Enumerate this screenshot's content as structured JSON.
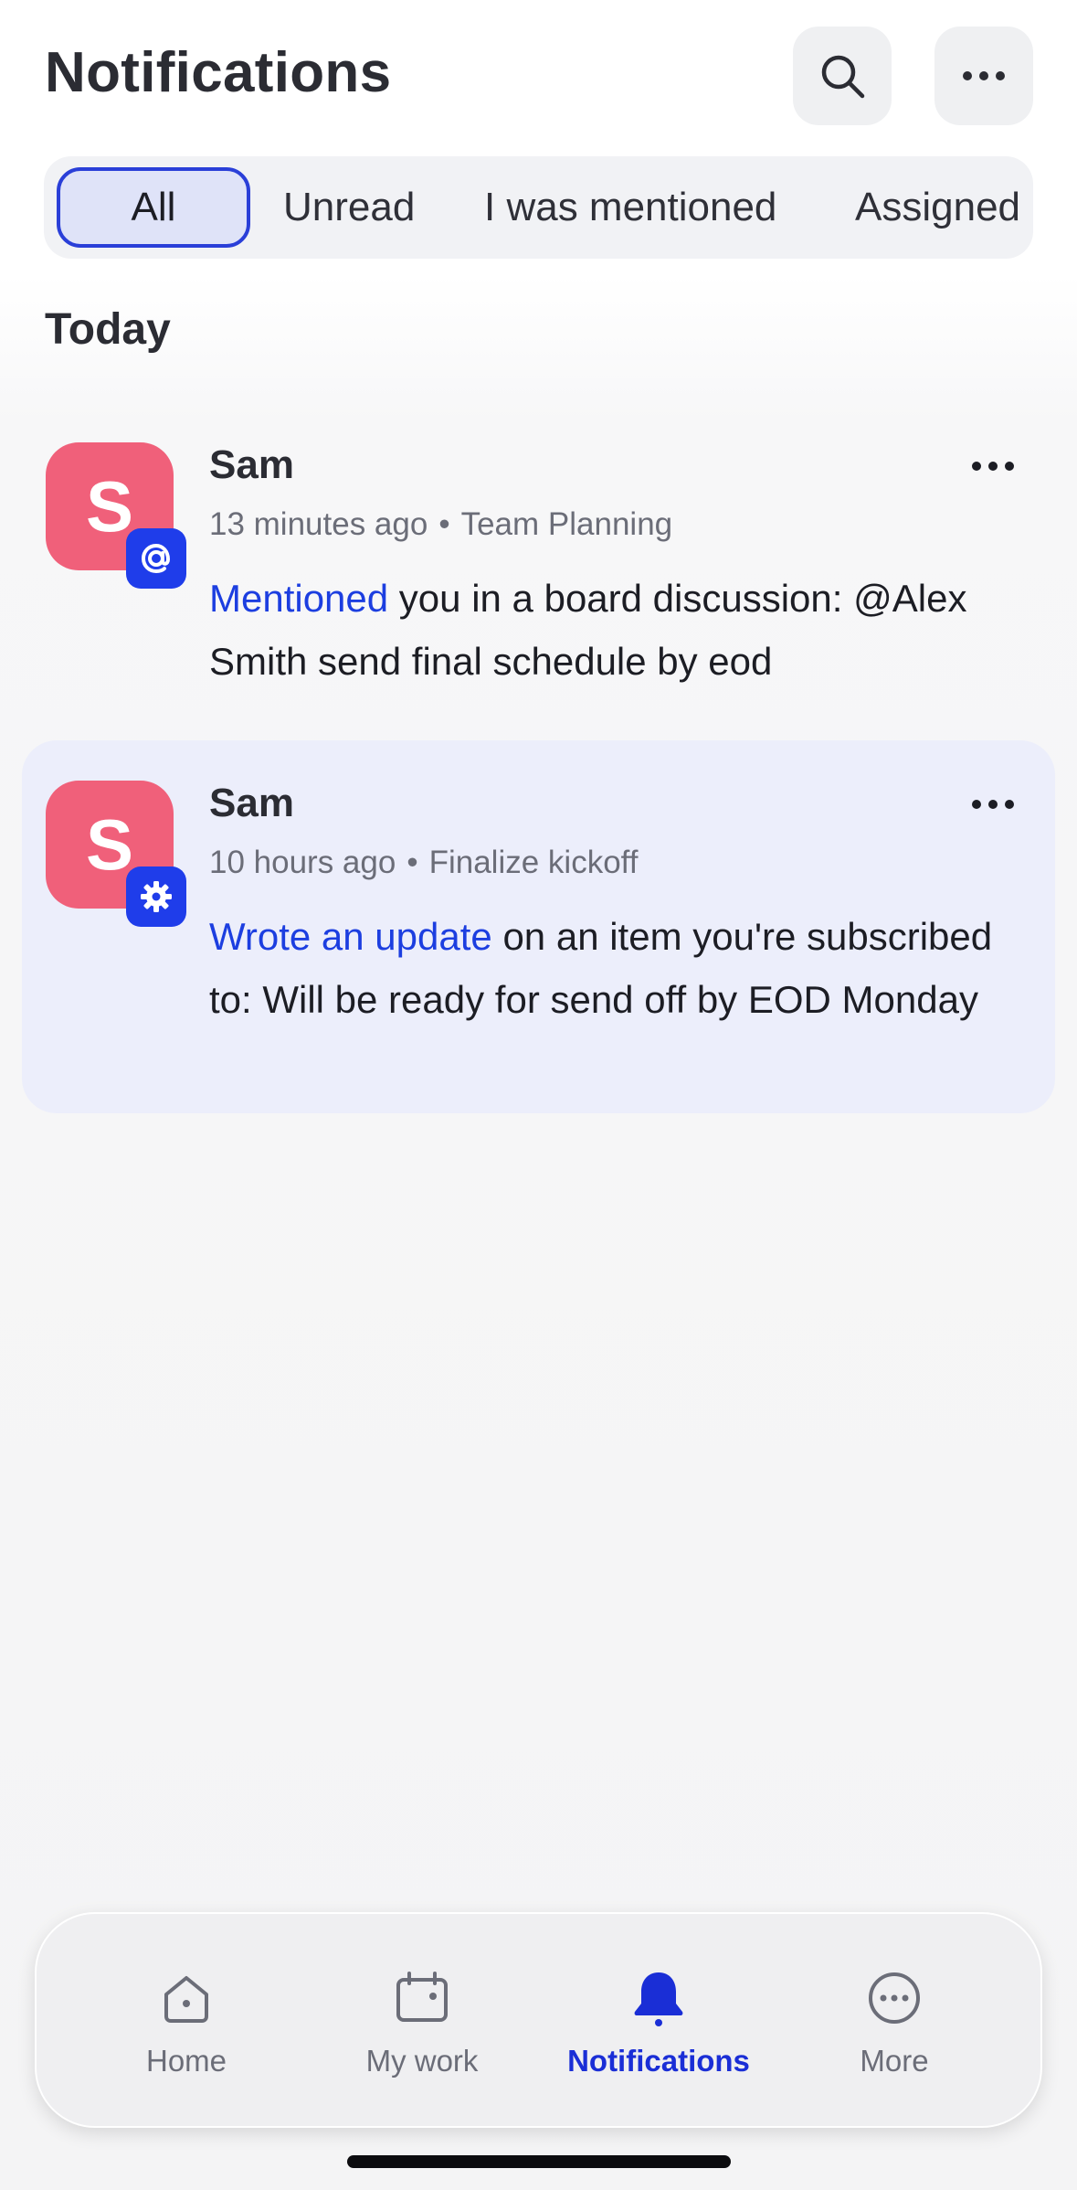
{
  "header": {
    "title": "Notifications",
    "search_icon": "search-icon",
    "more_icon": "more-horizontal-icon"
  },
  "filters": {
    "tabs": [
      {
        "label": "All",
        "active": true
      },
      {
        "label": "Unread",
        "active": false
      },
      {
        "label": "I was mentioned",
        "active": false
      },
      {
        "label": "Assigned",
        "active": false
      }
    ]
  },
  "section": {
    "title": "Today"
  },
  "notifications": [
    {
      "avatar_letter": "S",
      "sender": "Sam",
      "time": "13 minutes ago",
      "separator": "•",
      "context": "Team Planning",
      "badge_icon": "at-sign-icon",
      "action": "Mentioned",
      "message": " you in a board discussion: @Alex Smith send final schedule by eod",
      "highlighted": false
    },
    {
      "avatar_letter": "S",
      "sender": "Sam",
      "time": "10 hours ago",
      "separator": "•",
      "context": "Finalize kickoff",
      "badge_icon": "gear-icon",
      "action": "Wrote an update",
      "message": " on an item you're subscribed to: Will be ready for send off by EOD Monday",
      "highlighted": true
    }
  ],
  "bottom_nav": {
    "items": [
      {
        "label": "Home",
        "icon": "home-icon",
        "active": false
      },
      {
        "label": "My work",
        "icon": "calendar-icon",
        "active": false
      },
      {
        "label": "Notifications",
        "icon": "bell-icon",
        "active": true
      },
      {
        "label": "More",
        "icon": "more-circle-icon",
        "active": false
      }
    ]
  },
  "colors": {
    "accent": "#1c3ee0",
    "avatar": "#f0607a",
    "badge": "#1f3dea",
    "highlight_card": "#eceefb",
    "active_tab_fill": "#dfe3f8"
  }
}
